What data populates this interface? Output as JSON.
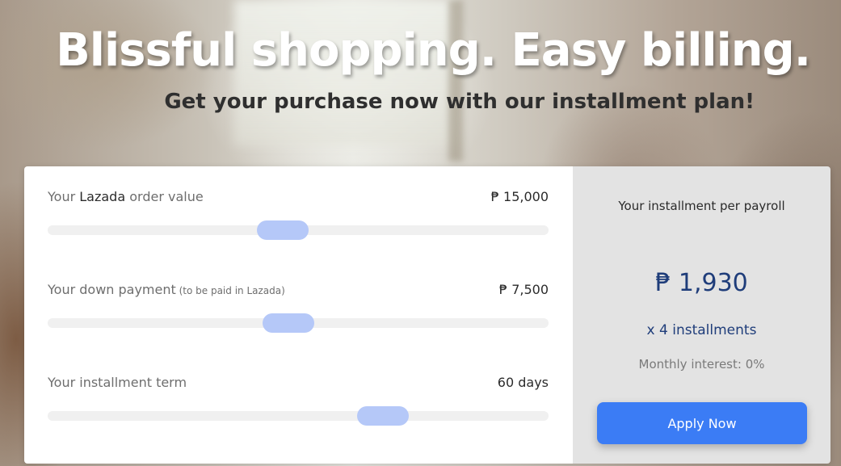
{
  "hero": {
    "headline": "Blissful shopping. Easy billing.",
    "subheadline": "Get your purchase now with our installment plan!"
  },
  "calculator": {
    "sliders": [
      {
        "label_prefix": "Your ",
        "label_strong": "Lazada",
        "label_suffix": " order value",
        "note": "",
        "value": "₱ 15,000",
        "level": 0.47
      },
      {
        "label_prefix": "Your down payment",
        "label_strong": "",
        "label_suffix": "",
        "note": " (to be paid in Lazada)",
        "value": "₱ 7,500",
        "level": 0.48
      },
      {
        "label_prefix": "Your installment term",
        "label_strong": "",
        "label_suffix": "",
        "note": "",
        "value": "60 days",
        "level": 0.67
      }
    ],
    "result": {
      "title": "Your installment per payroll",
      "amount": "₱ 1,930",
      "installments": "x 4 installments",
      "interest": "Monthly interest: 0%",
      "apply_label": "Apply Now"
    }
  },
  "colors": {
    "accent": "#3b7cf5",
    "thumb": "#b5c8f8",
    "amount_text": "#1f3d7a"
  }
}
